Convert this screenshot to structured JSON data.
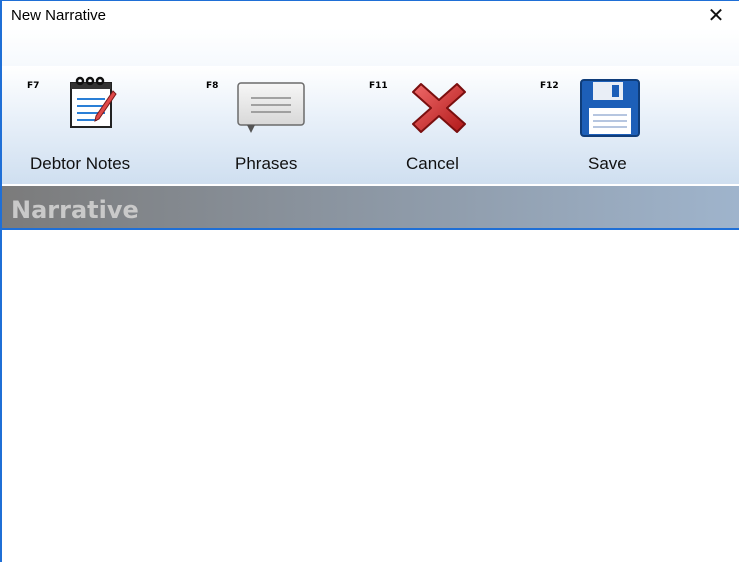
{
  "window": {
    "title": "New Narrative",
    "close_glyph": "✕"
  },
  "toolbar": {
    "buttons": [
      {
        "fkey": "F7",
        "label": "Debtor Notes",
        "icon": "notepad-icon"
      },
      {
        "fkey": "F8",
        "label": "Phrases",
        "icon": "speech-bubble-icon"
      },
      {
        "fkey": "F11",
        "label": "Cancel",
        "icon": "red-x-icon"
      },
      {
        "fkey": "F12",
        "label": "Save",
        "icon": "floppy-disk-icon"
      }
    ]
  },
  "narrative": {
    "header": "Narrative",
    "value": ""
  },
  "colors": {
    "accent": "#1f6fd6",
    "cancel_red": "#d42a2a",
    "save_blue": "#1d5fb8"
  }
}
